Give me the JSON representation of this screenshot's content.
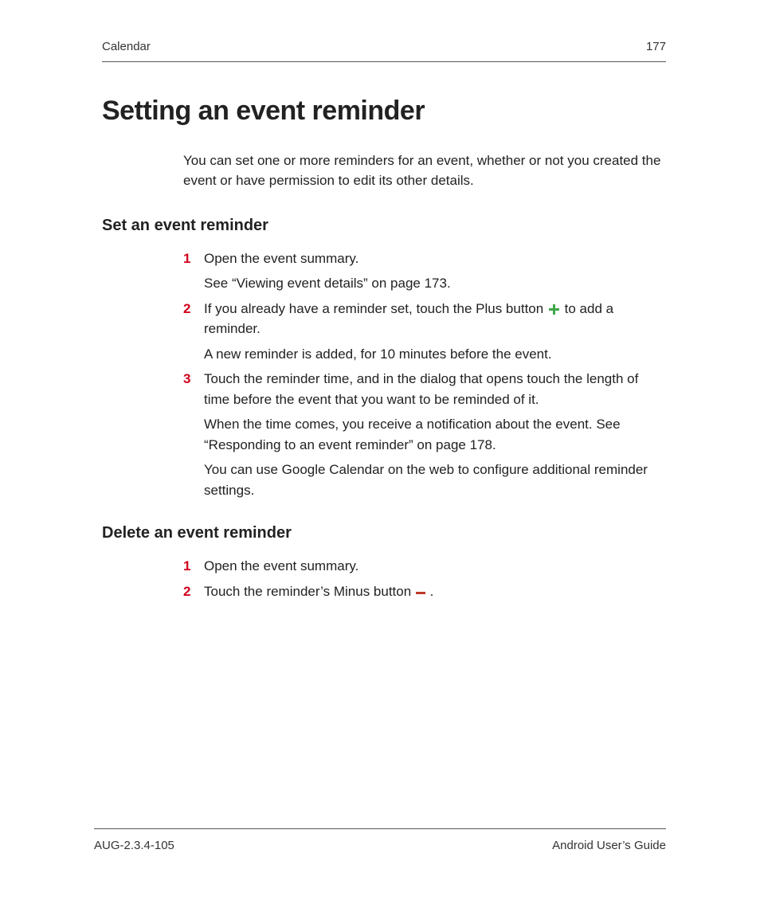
{
  "header": {
    "section": "Calendar",
    "page_number": "177"
  },
  "title": "Setting an event reminder",
  "intro": "You can set one or more reminders for an event, whether or not you created the event or have permission to edit its other details.",
  "section_set": {
    "heading": "Set an event reminder",
    "steps": {
      "s1_a": "Open the event summary.",
      "s1_b": "See “Viewing event details” on page 173.",
      "s2_a_pre": "If you already have a reminder set, touch the Plus button ",
      "s2_a_post": " to add a reminder.",
      "s2_b": "A new reminder is added, for 10 minutes before the event.",
      "s3_a": "Touch the reminder time, and in the dialog that opens touch the length of time before the event that you want to be reminded of it.",
      "s3_b": "When the time comes, you receive a notification about the event. See “Responding to an event reminder” on page 178.",
      "s3_c": "You can use Google Calendar on the web to configure additional reminder settings."
    }
  },
  "section_delete": {
    "heading": "Delete an event reminder",
    "steps": {
      "d1": "Open the event summary.",
      "d2_pre": "Touch the reminder’s Minus button ",
      "d2_post": "."
    }
  },
  "footer": {
    "doc_id": "AUG-2.3.4-105",
    "guide": "Android User’s Guide"
  },
  "icons": {
    "plus": "plus-icon",
    "minus": "minus-icon"
  },
  "colors": {
    "step_number": "#d0021b",
    "plus": "#3fa648",
    "minus": "#c0392b"
  }
}
